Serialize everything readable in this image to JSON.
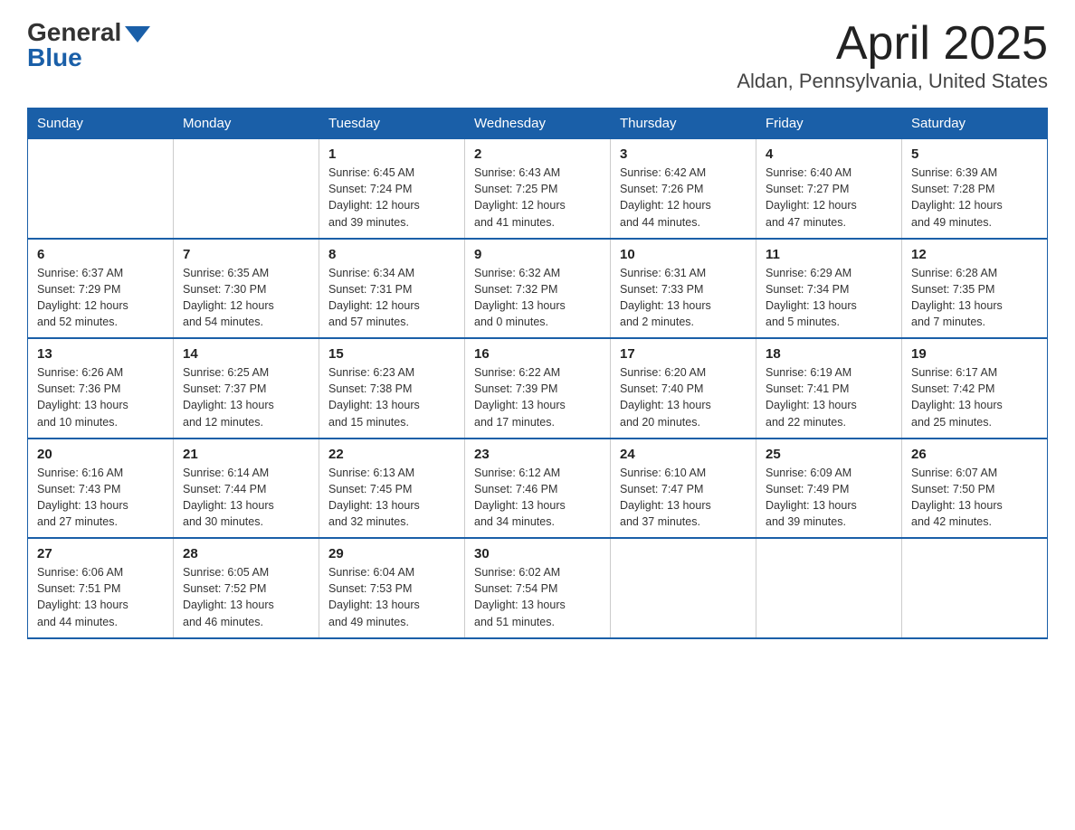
{
  "header": {
    "logo_general": "General",
    "logo_blue": "Blue",
    "title": "April 2025",
    "subtitle": "Aldan, Pennsylvania, United States"
  },
  "days_of_week": [
    "Sunday",
    "Monday",
    "Tuesday",
    "Wednesday",
    "Thursday",
    "Friday",
    "Saturday"
  ],
  "weeks": [
    [
      {
        "day": "",
        "info": ""
      },
      {
        "day": "",
        "info": ""
      },
      {
        "day": "1",
        "info": "Sunrise: 6:45 AM\nSunset: 7:24 PM\nDaylight: 12 hours\nand 39 minutes."
      },
      {
        "day": "2",
        "info": "Sunrise: 6:43 AM\nSunset: 7:25 PM\nDaylight: 12 hours\nand 41 minutes."
      },
      {
        "day": "3",
        "info": "Sunrise: 6:42 AM\nSunset: 7:26 PM\nDaylight: 12 hours\nand 44 minutes."
      },
      {
        "day": "4",
        "info": "Sunrise: 6:40 AM\nSunset: 7:27 PM\nDaylight: 12 hours\nand 47 minutes."
      },
      {
        "day": "5",
        "info": "Sunrise: 6:39 AM\nSunset: 7:28 PM\nDaylight: 12 hours\nand 49 minutes."
      }
    ],
    [
      {
        "day": "6",
        "info": "Sunrise: 6:37 AM\nSunset: 7:29 PM\nDaylight: 12 hours\nand 52 minutes."
      },
      {
        "day": "7",
        "info": "Sunrise: 6:35 AM\nSunset: 7:30 PM\nDaylight: 12 hours\nand 54 minutes."
      },
      {
        "day": "8",
        "info": "Sunrise: 6:34 AM\nSunset: 7:31 PM\nDaylight: 12 hours\nand 57 minutes."
      },
      {
        "day": "9",
        "info": "Sunrise: 6:32 AM\nSunset: 7:32 PM\nDaylight: 13 hours\nand 0 minutes."
      },
      {
        "day": "10",
        "info": "Sunrise: 6:31 AM\nSunset: 7:33 PM\nDaylight: 13 hours\nand 2 minutes."
      },
      {
        "day": "11",
        "info": "Sunrise: 6:29 AM\nSunset: 7:34 PM\nDaylight: 13 hours\nand 5 minutes."
      },
      {
        "day": "12",
        "info": "Sunrise: 6:28 AM\nSunset: 7:35 PM\nDaylight: 13 hours\nand 7 minutes."
      }
    ],
    [
      {
        "day": "13",
        "info": "Sunrise: 6:26 AM\nSunset: 7:36 PM\nDaylight: 13 hours\nand 10 minutes."
      },
      {
        "day": "14",
        "info": "Sunrise: 6:25 AM\nSunset: 7:37 PM\nDaylight: 13 hours\nand 12 minutes."
      },
      {
        "day": "15",
        "info": "Sunrise: 6:23 AM\nSunset: 7:38 PM\nDaylight: 13 hours\nand 15 minutes."
      },
      {
        "day": "16",
        "info": "Sunrise: 6:22 AM\nSunset: 7:39 PM\nDaylight: 13 hours\nand 17 minutes."
      },
      {
        "day": "17",
        "info": "Sunrise: 6:20 AM\nSunset: 7:40 PM\nDaylight: 13 hours\nand 20 minutes."
      },
      {
        "day": "18",
        "info": "Sunrise: 6:19 AM\nSunset: 7:41 PM\nDaylight: 13 hours\nand 22 minutes."
      },
      {
        "day": "19",
        "info": "Sunrise: 6:17 AM\nSunset: 7:42 PM\nDaylight: 13 hours\nand 25 minutes."
      }
    ],
    [
      {
        "day": "20",
        "info": "Sunrise: 6:16 AM\nSunset: 7:43 PM\nDaylight: 13 hours\nand 27 minutes."
      },
      {
        "day": "21",
        "info": "Sunrise: 6:14 AM\nSunset: 7:44 PM\nDaylight: 13 hours\nand 30 minutes."
      },
      {
        "day": "22",
        "info": "Sunrise: 6:13 AM\nSunset: 7:45 PM\nDaylight: 13 hours\nand 32 minutes."
      },
      {
        "day": "23",
        "info": "Sunrise: 6:12 AM\nSunset: 7:46 PM\nDaylight: 13 hours\nand 34 minutes."
      },
      {
        "day": "24",
        "info": "Sunrise: 6:10 AM\nSunset: 7:47 PM\nDaylight: 13 hours\nand 37 minutes."
      },
      {
        "day": "25",
        "info": "Sunrise: 6:09 AM\nSunset: 7:49 PM\nDaylight: 13 hours\nand 39 minutes."
      },
      {
        "day": "26",
        "info": "Sunrise: 6:07 AM\nSunset: 7:50 PM\nDaylight: 13 hours\nand 42 minutes."
      }
    ],
    [
      {
        "day": "27",
        "info": "Sunrise: 6:06 AM\nSunset: 7:51 PM\nDaylight: 13 hours\nand 44 minutes."
      },
      {
        "day": "28",
        "info": "Sunrise: 6:05 AM\nSunset: 7:52 PM\nDaylight: 13 hours\nand 46 minutes."
      },
      {
        "day": "29",
        "info": "Sunrise: 6:04 AM\nSunset: 7:53 PM\nDaylight: 13 hours\nand 49 minutes."
      },
      {
        "day": "30",
        "info": "Sunrise: 6:02 AM\nSunset: 7:54 PM\nDaylight: 13 hours\nand 51 minutes."
      },
      {
        "day": "",
        "info": ""
      },
      {
        "day": "",
        "info": ""
      },
      {
        "day": "",
        "info": ""
      }
    ]
  ]
}
